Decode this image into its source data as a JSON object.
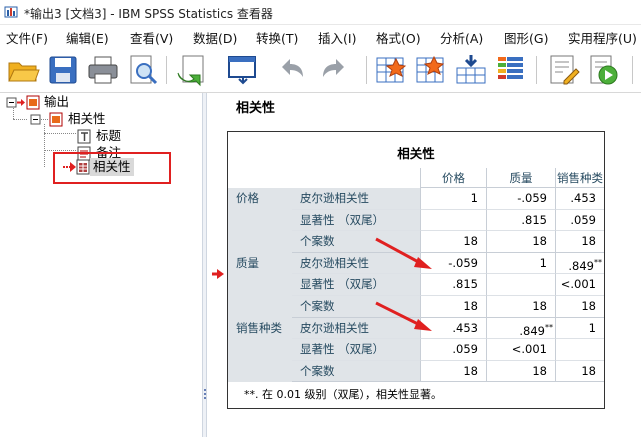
{
  "window": {
    "title": "*输出3 [文档3] - IBM SPSS Statistics 查看器"
  },
  "menu": [
    "文件(F)",
    "编辑(E)",
    "查看(V)",
    "数据(D)",
    "转换(T)",
    "插入(I)",
    "格式(O)",
    "分析(A)",
    "图形(G)",
    "实用程序(U)"
  ],
  "toolbar": {
    "icons": [
      "open-folder-icon",
      "save-icon",
      "print-icon",
      "print-preview-icon",
      "export-icon",
      "recall-dialog-icon",
      "undo-icon",
      "redo-icon",
      "goto-data-icon",
      "goto-case-icon",
      "goto-variable-icon",
      "variables-icon",
      "create-title-icon",
      "run-script-icon"
    ]
  },
  "outline": {
    "root": "输出",
    "child": "相关性",
    "leaves": [
      "标题",
      "备注",
      "相关性"
    ]
  },
  "output": {
    "heading": "相关性",
    "table": {
      "title": "相关性",
      "columns": [
        "价格",
        "质量",
        "销售种类"
      ],
      "rows": [
        {
          "group": "价格",
          "stat": "皮尔逊相关性",
          "values": [
            "1",
            "-.059",
            ".453"
          ]
        },
        {
          "group": "",
          "stat": "显著性 （双尾）",
          "values": [
            "",
            ".815",
            ".059"
          ]
        },
        {
          "group": "",
          "stat": "个案数",
          "values": [
            "18",
            "18",
            "18"
          ]
        },
        {
          "group": "质量",
          "stat": "皮尔逊相关性",
          "values": [
            "-.059",
            "1",
            ".849"
          ],
          "sup": [
            "",
            "",
            "**"
          ]
        },
        {
          "group": "",
          "stat": "显著性 （双尾）",
          "values": [
            ".815",
            "",
            "<.001"
          ]
        },
        {
          "group": "",
          "stat": "个案数",
          "values": [
            "18",
            "18",
            "18"
          ]
        },
        {
          "group": "销售种类",
          "stat": "皮尔逊相关性",
          "values": [
            ".453",
            ".849",
            "1"
          ],
          "sup": [
            "",
            "**",
            ""
          ]
        },
        {
          "group": "",
          "stat": "显著性 （双尾）",
          "values": [
            ".059",
            "<.001",
            ""
          ]
        },
        {
          "group": "",
          "stat": "个案数",
          "values": [
            "18",
            "18",
            "18"
          ]
        }
      ],
      "footnote": "**. 在 0.01 级别（双尾），相关性显著。"
    }
  },
  "colors": {
    "accent_red": "#e02020",
    "label_blue": "#264a60",
    "shade": "#e0e4e8"
  }
}
